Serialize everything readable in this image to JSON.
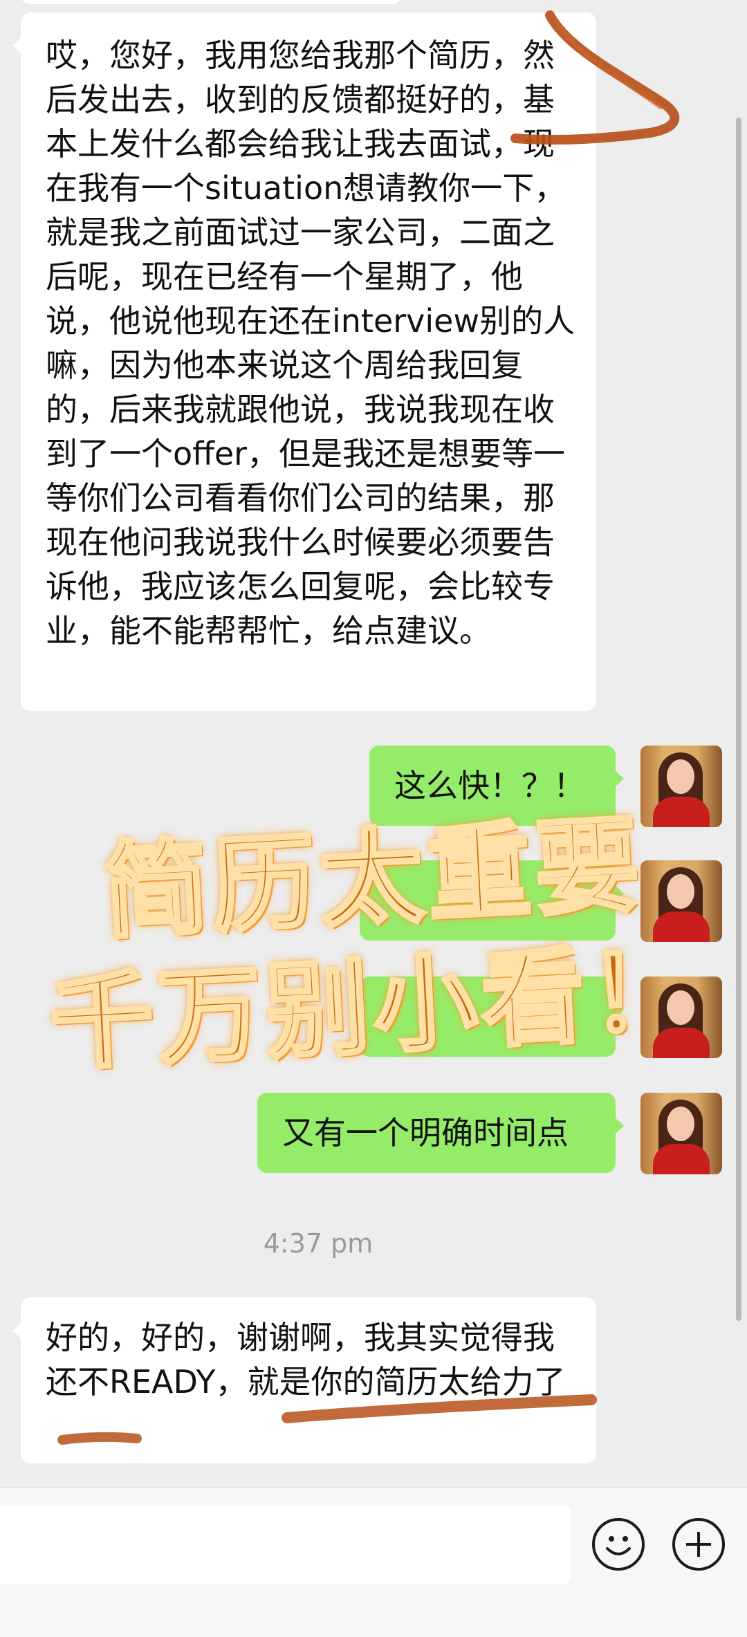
{
  "messages": {
    "incoming_1": "哎，您好，我用您给我那个简历，然后发出去，收到的反馈都挺好的，基本上发什么都会给我让我去面试，现在我有一个situation想请教你一下，就是我之前面试过一家公司，二面之后呢，现在已经有一个星期了，他说，他说他现在还在interview别的人嘛，因为他本来说这个周给我回复的，后来我就跟他说，我说我现在收到了一个offer，但是我还是想要等一等你们公司看看你们公司的结果，那现在他问我说我什么时候要必须要告诉他，我应该怎么回复呢，会比较专业，能不能帮帮忙，给点建议。",
    "outgoing_1": "这么快！？！",
    "outgoing_4": "又有一个明确时间点",
    "incoming_2": "好的，好的，谢谢啊，我其实觉得我还不READY，就是你的简历太给力了"
  },
  "timestamp": "4:37 pm",
  "overlay": {
    "line1": "简历太重要",
    "line2": "千万别小看！"
  },
  "input_bar": {
    "emoji_icon": "emoji-icon",
    "plus_icon": "plus-icon"
  },
  "colors": {
    "background": "#ededed",
    "incoming_bubble": "#ffffff",
    "outgoing_bubble": "#95ec69",
    "overlay_text": "#c76a0b",
    "pen_stroke": "#b8501a"
  }
}
